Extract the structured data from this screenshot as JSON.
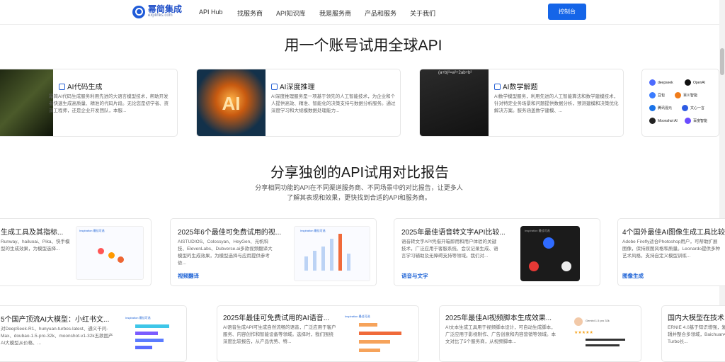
{
  "nav": {
    "logo_title": "幂简集成",
    "logo_sub": "explinks.com",
    "items": [
      "API Hub",
      "找服务商",
      "API知识库",
      "我是服务商",
      "产品和服务",
      "关于我们"
    ],
    "console": "控制台"
  },
  "section1": {
    "title": "用一个账号试用全球API",
    "cards": [
      {
        "title": "AI代码生成",
        "desc": "幂简AI代码生成服务利用先进的大语言模型技术，帮助开发者快速生成高质量、精准的代码片段。无论您是初学者、资深工程师，还是企业开发团队，本服..."
      },
      {
        "title": "AI深度推理",
        "desc": "AI深度推理服务是一项基于领先的人工智能技术，为企业和个人提供高效、精准、智能化的决策支持与数据分析服务。通过深度学习和大规模数据处理能力..."
      },
      {
        "title": "AI数学解题",
        "desc": "AI数学模型服务，利用先进的人工智能算法和数学建模技术，针对特定业务场景和问题提供数据分析，预测建模和决策优化解决方案。服务涵盖数学建模、..."
      }
    ],
    "image_text": {
      "ai": "AI",
      "math": "(a+b)²=a²+2ab+b²"
    },
    "logos": [
      "deepseek",
      "OpenAI",
      "豆包",
      "百川智能",
      "腾讯混元",
      "文心一言",
      "Moonshot AI",
      "百度智能"
    ]
  },
  "section2": {
    "title": "分享独创的API试用对比报告",
    "subtitle": "分享相同功能的API在不同渠道服务商、不同场景中的对比报告，让更多人了解其表现和效果，更快找到合适的API和服务商。",
    "row1": [
      {
        "title": "生成工具及其指标...",
        "desc": "Runway、hailuoai、Pika、快手模型的生成效果，为模型选择...",
        "tag": ""
      },
      {
        "title": "2025年6个最佳可免费试用的视...",
        "desc": "AISTUDIOS、Colossyan、HeyGen、光帆科技、ElevenLabs、Dubverse.ai多款视频翻译大模型的生成效果，为模型选择与应用提供参考依...",
        "tag": "视频翻译"
      },
      {
        "title": "2025年最佳语音转文字API比较...",
        "desc": "语音转文字API凭借开箱即用和用户体验的关键技术，广泛应用于客服系统、会议记录生成、语言学习辅助及无障碍支持等领域。我们对...",
        "tag": "语音与文字"
      },
      {
        "title": "4个国外最佳AI图像生成工具比较",
        "desc": "Adobe Firefly适合Photoshop用户，可帮助扩展图像，保持原图风格和质量。Leonardo提供多种艺术风格，支持自定义模型训练...",
        "tag": "图像生成"
      }
    ],
    "row2": [
      {
        "title": "5个国产顶流AI大模型：小红书文...",
        "desc": "对DeepSeek-R1、hunyuan-turbos-latest、通义千问-Max、doubao-1.5-pro-32k、moonshot-v1-32k五款国产AI大模型从价格、..."
      },
      {
        "title": "2025年最佳可免费试用的AI语音...",
        "desc": "AI语音生成API可生成自然流畅的语音，广泛应用于客户服务、内容创作和智能设备等领域。选择时，我们围绕深度比较报告，从产品优势、特..."
      },
      {
        "title": "2025年最佳AI视频脚本生成效果...",
        "desc": "AI文本生成工具用于视频脚本设计，可自动生成脚本，广泛应用于影视制作、广告创意和内容营销等领域。本文对比了5个服务商，从视频脚本..."
      },
      {
        "title": "国内大模型在技术...",
        "desc": "ERNIE 4.0基于知识增强，复杂逻辑并整合多领域，Baichuan4 Turbo长..."
      }
    ],
    "thumb_labels": {
      "video": "Inspiration 最佳可选",
      "chart": "Inspiration 最佳可选",
      "voice": "Inspiration 最佳可选",
      "voice_model": "Gemini 1.5 pro 32k"
    }
  }
}
